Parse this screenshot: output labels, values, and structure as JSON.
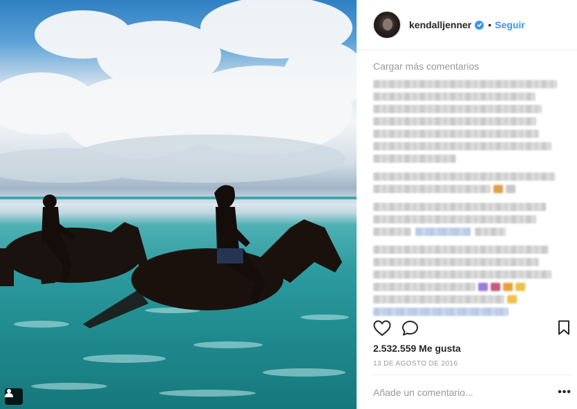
{
  "post": {
    "author": {
      "username": "kendalljenner",
      "verified": true,
      "follow_label": "Seguir",
      "separator": "•"
    },
    "load_more_label": "Cargar más comentarios",
    "likes_label": "2.532.559 Me gusta",
    "date_label": "13 de agosto de 2016",
    "comment_placeholder": "Añade un comentario...",
    "more_label": "•••"
  },
  "icons": {
    "like": "heart-icon",
    "comment": "speech-bubble-icon",
    "save": "bookmark-icon",
    "tag": "user-tag-icon",
    "verified": "verified-badge-icon"
  },
  "colors": {
    "accent": "#3897f0",
    "text": "#262626",
    "muted": "#999999",
    "divider": "#efefef"
  }
}
